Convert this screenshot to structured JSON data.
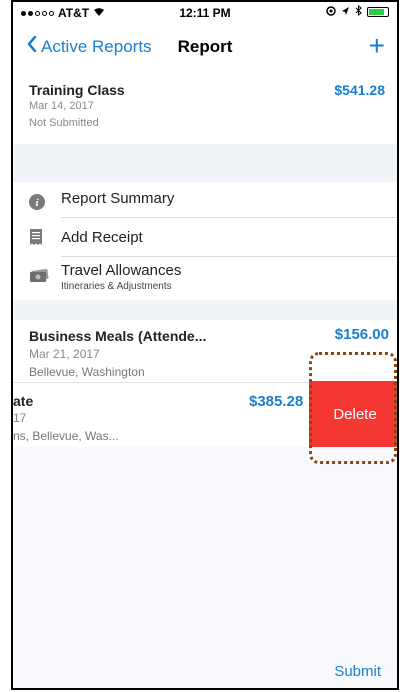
{
  "status_bar": {
    "carrier": "AT&T",
    "time": "12:11 PM"
  },
  "nav": {
    "back_label": "Active Reports",
    "title": "Report",
    "add_glyph": "+"
  },
  "report": {
    "name": "Training Class",
    "date": "Mar 14, 2017",
    "status": "Not Submitted",
    "amount": "$541.28"
  },
  "menu": [
    {
      "label": "Report Summary",
      "icon": "info-icon"
    },
    {
      "label": "Add Receipt",
      "icon": "receipt-icon"
    },
    {
      "label": "Travel Allowances",
      "sub": "Itineraries & Adjustments",
      "icon": "money-icon"
    }
  ],
  "expenses": [
    {
      "name": "Business Meals (Attende...",
      "date": "Mar 21, 2017",
      "location": "Bellevue, Washington",
      "amount": "$156.00"
    },
    {
      "name": "ate",
      "date": "17",
      "location": "ns, Bellevue, Was...",
      "amount": "$385.28"
    }
  ],
  "swipe_action": {
    "label": "Delete"
  },
  "footer": {
    "submit_label": "Submit"
  },
  "colors": {
    "accent": "#1a7fd0",
    "delete": "#f53733",
    "highlight": "#8b4513"
  }
}
